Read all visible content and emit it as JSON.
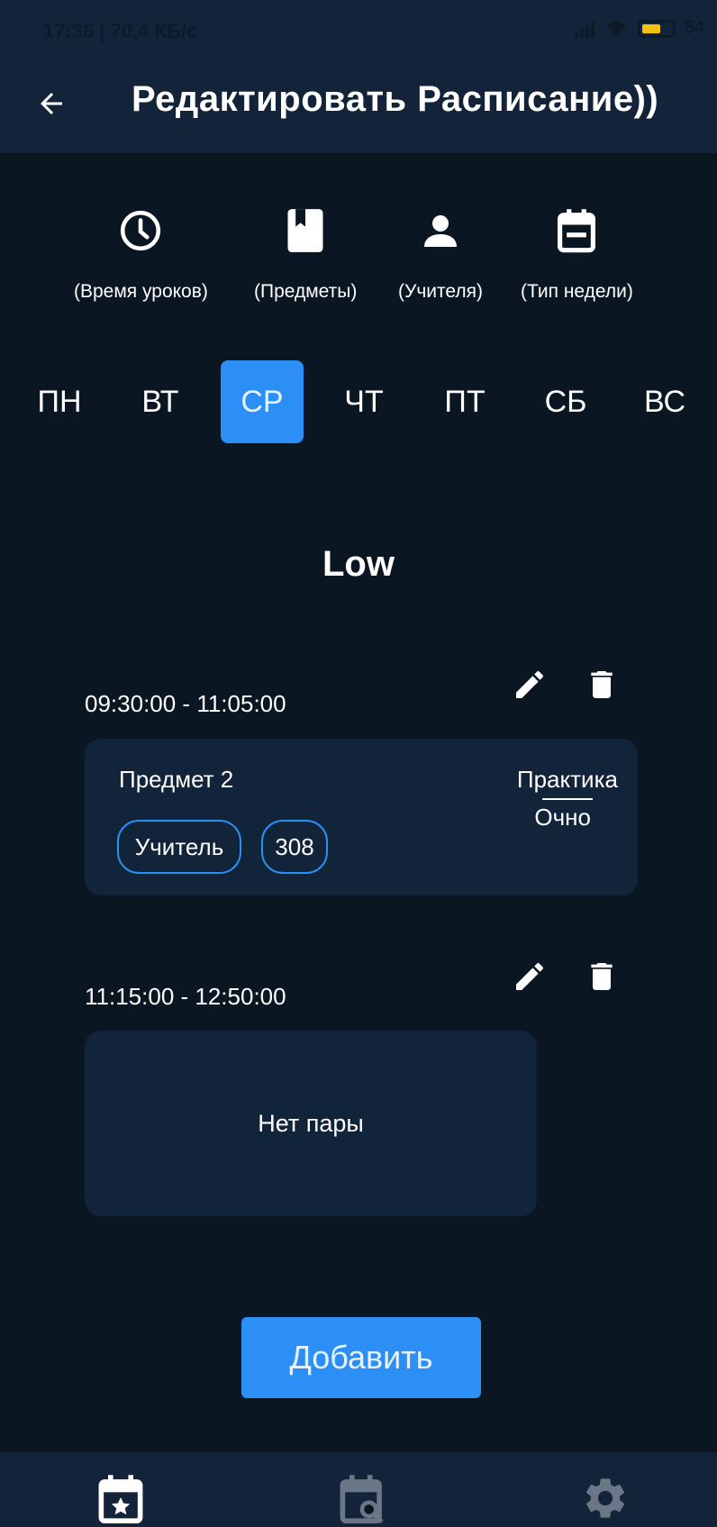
{
  "status_bar": {
    "time": "17:36 | 70,4 КБ/с",
    "battery": "54"
  },
  "app_bar": {
    "title": "Редактировать Расписание))"
  },
  "quick_links": [
    {
      "label": "(Время уроков)",
      "icon": "clock-icon"
    },
    {
      "label": "(Предметы)",
      "icon": "book-icon"
    },
    {
      "label": "(Учителя)",
      "icon": "person-icon"
    },
    {
      "label": "(Тип недели)",
      "icon": "calendar-icon"
    }
  ],
  "days": [
    "ПН",
    "ВТ",
    "СР",
    "ЧТ",
    "ПТ",
    "СБ",
    "ВС"
  ],
  "selected_day": "СР",
  "week_type": "Low",
  "lessons": [
    {
      "time": "09:30:00 - 11:05:00",
      "subject": "Предмет 2",
      "type": "Практика",
      "format": "Очно",
      "teacher": "Учитель",
      "room": "308"
    },
    {
      "time": "11:15:00 - 12:50:00",
      "empty_text": "Нет пары"
    }
  ],
  "add_button": "Добавить",
  "bottom_nav": [
    "calendar-star-icon",
    "calendar-search-icon",
    "gear-icon"
  ],
  "colors": {
    "background": "#0b1623",
    "bar": "#13233a",
    "card": "#12243a",
    "accent": "#2b8ff5"
  }
}
